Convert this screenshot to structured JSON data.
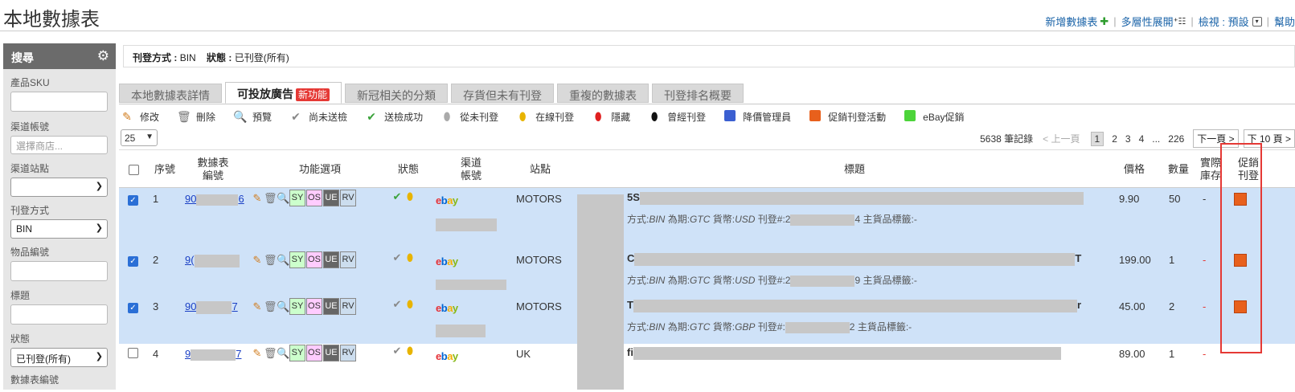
{
  "page_title": "本地數據表",
  "top_links": {
    "new_sheet": "新增數據表",
    "multi_expand": "多層性展開",
    "view_label": "檢視 : 預設",
    "help": "幫助"
  },
  "sidebar": {
    "header": "搜尋",
    "sku_label": "產品SKU",
    "account_label": "渠道帳號",
    "account_placeholder": "選擇商店...",
    "site_label": "渠道站點",
    "site_value": "",
    "listing_method_label": "刊登方式",
    "listing_method_value": "BIN",
    "item_no_label": "物品編號",
    "title_label": "標題",
    "status_label": "狀態",
    "status_value": "已刊登(所有)",
    "sheet_no_label": "數據表編號"
  },
  "filter_summary": {
    "method_key": "刊登方式 :",
    "method_val": "BIN",
    "status_key": "狀態 :",
    "status_val": "已刊登(所有)"
  },
  "tabs": [
    {
      "label": "本地數據表詳情"
    },
    {
      "label": "可投放廣告",
      "badge": "新功能"
    },
    {
      "label": "新冠相关的分類"
    },
    {
      "label": "存貨但未有刊登"
    },
    {
      "label": "重複的數據表"
    },
    {
      "label": "刊登排名概要"
    }
  ],
  "legend": [
    {
      "icon": "pencil-icon",
      "label": "修改"
    },
    {
      "icon": "trash-icon",
      "label": "刪除"
    },
    {
      "icon": "magnifier-icon",
      "label": "預覽"
    },
    {
      "icon": "grey-check-icon",
      "label": "尚未送檢"
    },
    {
      "icon": "green-check-icon",
      "label": "送檢成功"
    },
    {
      "icon": "grey-tag-icon",
      "label": "從未刊登"
    },
    {
      "icon": "yellow-tag-icon",
      "label": "在線刊登"
    },
    {
      "icon": "red-tag-icon",
      "label": "隱藏"
    },
    {
      "icon": "black-tag-icon",
      "label": "曾經刊登"
    },
    {
      "icon": "blue-square-icon",
      "label": "降價管理員",
      "color": "#3b5fd1"
    },
    {
      "icon": "orange-square-icon",
      "label": "促銷刊登活動",
      "color": "#e8601c"
    },
    {
      "icon": "green-square-icon",
      "label": "eBay促銷",
      "color": "#4cd43a"
    }
  ],
  "pager": {
    "per_page": "25",
    "records": "5638 筆記錄",
    "prev": "< 上一頁",
    "pages": [
      "1",
      "2",
      "3",
      "4",
      "...",
      "226"
    ],
    "next": "下一頁 >",
    "next10": "下 10 頁 >"
  },
  "columns": {
    "seq": "序號",
    "sheet_no": "數據表\n編號",
    "functions": "功能選項",
    "status": "狀態",
    "channel_account": "渠道\n帳號",
    "site": "站點",
    "title": "標題",
    "price": "價格",
    "qty": "數量",
    "actual_stock": "實際\n庫存",
    "promo": "促銷\n刊登"
  },
  "func_buttons": [
    "SY",
    "OS",
    "UE",
    "RV"
  ],
  "rows": [
    {
      "seq": "1",
      "sheet_no_prefix": "90",
      "sheet_no_suffix": "6",
      "site": "MOTORS",
      "title_prefix": "5S",
      "title_suffix": "",
      "sub_method": "BIN",
      "sub_period": "GTC",
      "sub_currency": "USD",
      "sub_listing_prefix": "2",
      "sub_listing_suffix": "4",
      "price": "9.90",
      "qty": "50",
      "stock": "-",
      "selected": true
    },
    {
      "seq": "2",
      "sheet_no_prefix": "9(",
      "sheet_no_suffix": "",
      "site": "MOTORS",
      "title_prefix": "C",
      "title_suffix": "T",
      "sub_method": "BIN",
      "sub_period": "GTC",
      "sub_currency": "USD",
      "sub_listing_prefix": "2",
      "sub_listing_suffix": "9",
      "price": "199.00",
      "qty": "1",
      "stock": "-",
      "selected": true
    },
    {
      "seq": "3",
      "sheet_no_prefix": "90",
      "sheet_no_suffix": "7",
      "site": "MOTORS",
      "title_prefix": "T",
      "title_suffix": "r",
      "sub_method": "BIN",
      "sub_period": "GTC",
      "sub_currency": "GBP",
      "sub_listing_prefix": "",
      "sub_listing_suffix": "2",
      "price": "45.00",
      "qty": "2",
      "stock": "-",
      "selected": true
    },
    {
      "seq": "4",
      "sheet_no_prefix": "9",
      "sheet_no_suffix": "7",
      "site": "UK",
      "title_prefix": "fi",
      "title_suffix": "",
      "sub_method": "",
      "sub_period": "",
      "sub_currency": "",
      "sub_listing_prefix": "",
      "sub_listing_suffix": "",
      "price": "89.00",
      "qty": "1",
      "stock": "-",
      "selected": false
    }
  ],
  "sub_labels": {
    "method": "方式:",
    "period": "為期:",
    "currency": "貨幣:",
    "listing": "刊登#:",
    "main_tag": "主貨品標籤:-"
  }
}
